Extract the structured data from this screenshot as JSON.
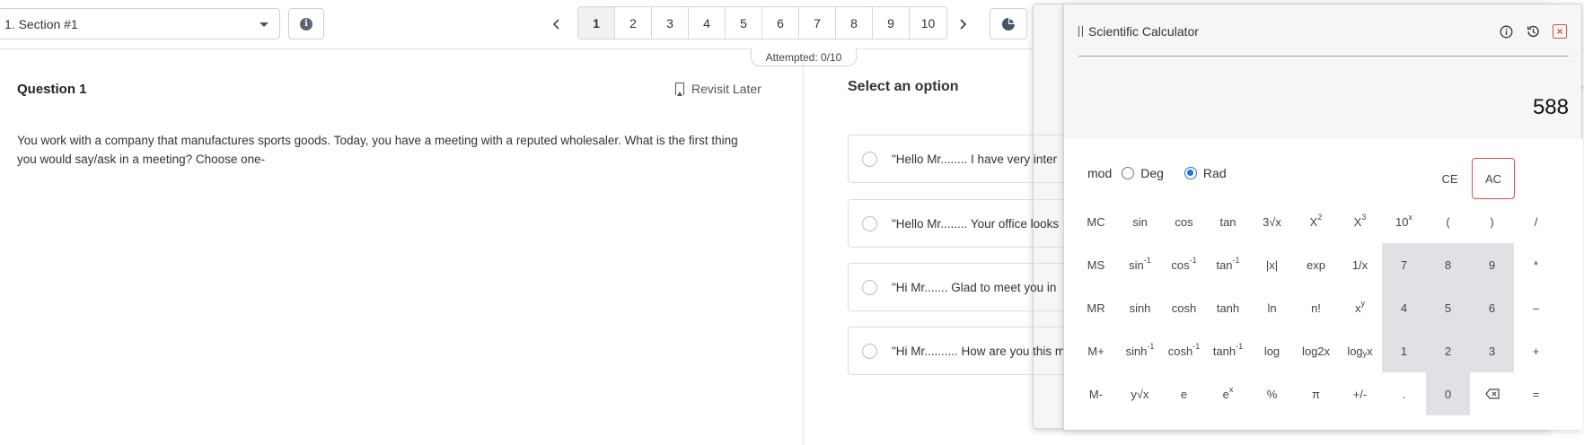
{
  "header": {
    "section_label": "1. Section #1",
    "pages": [
      "1",
      "2",
      "3",
      "4",
      "5",
      "6",
      "7",
      "8",
      "9",
      "10"
    ],
    "active_page": "1",
    "prev_icon": "chevron-left-icon",
    "next_icon": "chevron-right-icon",
    "attempted": "Attempted: 0/10"
  },
  "question": {
    "title": "Question 1",
    "revisit_label": "Revisit Later",
    "text": "You work with a company that manufactures sports goods. Today, you have a meeting with a reputed wholesaler. What is the first thing you would say/ask in a meeting? Choose one-"
  },
  "options": {
    "heading": "Select an option",
    "items": [
      "\"Hello Mr........ I have very inter",
      "\"Hello Mr........ Your office looks",
      "\"Hi Mr....... Glad to meet you in",
      "\"Hi Mr.......... How are you this m"
    ]
  },
  "calculator": {
    "title": "Scientific Calculator",
    "display": "588",
    "mode_labels": {
      "mod": "mod",
      "deg": "Deg",
      "rad": "Rad"
    },
    "selected_mode": "Rad",
    "ce": "CE",
    "ac": "AC",
    "accent_color": "#1976d2",
    "close_color": "#d9534f"
  },
  "edge_text": "e"
}
